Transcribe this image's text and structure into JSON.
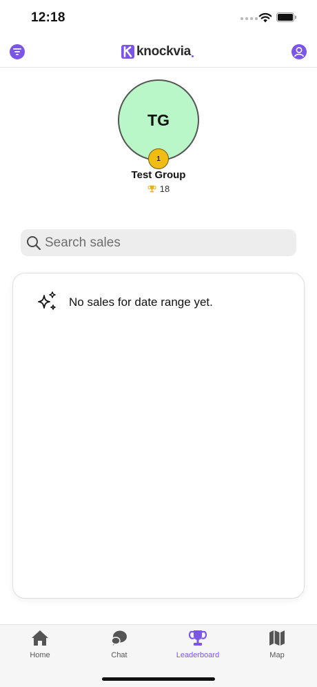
{
  "status_bar": {
    "time": "12:18"
  },
  "header": {
    "logo_text": "knockvia"
  },
  "group": {
    "initials": "TG",
    "rank": "1",
    "name": "Test Group",
    "score": "18"
  },
  "search": {
    "placeholder": "Search sales",
    "value": ""
  },
  "sales": {
    "empty_message": "No sales for date range yet."
  },
  "tabs": [
    {
      "label": "Home",
      "icon": "home-icon",
      "active": false
    },
    {
      "label": "Chat",
      "icon": "chat-icon",
      "active": false
    },
    {
      "label": "Leaderboard",
      "icon": "trophy-icon",
      "active": true
    },
    {
      "label": "Map",
      "icon": "map-icon",
      "active": false
    }
  ],
  "colors": {
    "accent": "#7b55e8",
    "avatar_bg": "#b9f7c8",
    "badge": "#f2bd12",
    "trophy": "#e8b40c"
  }
}
